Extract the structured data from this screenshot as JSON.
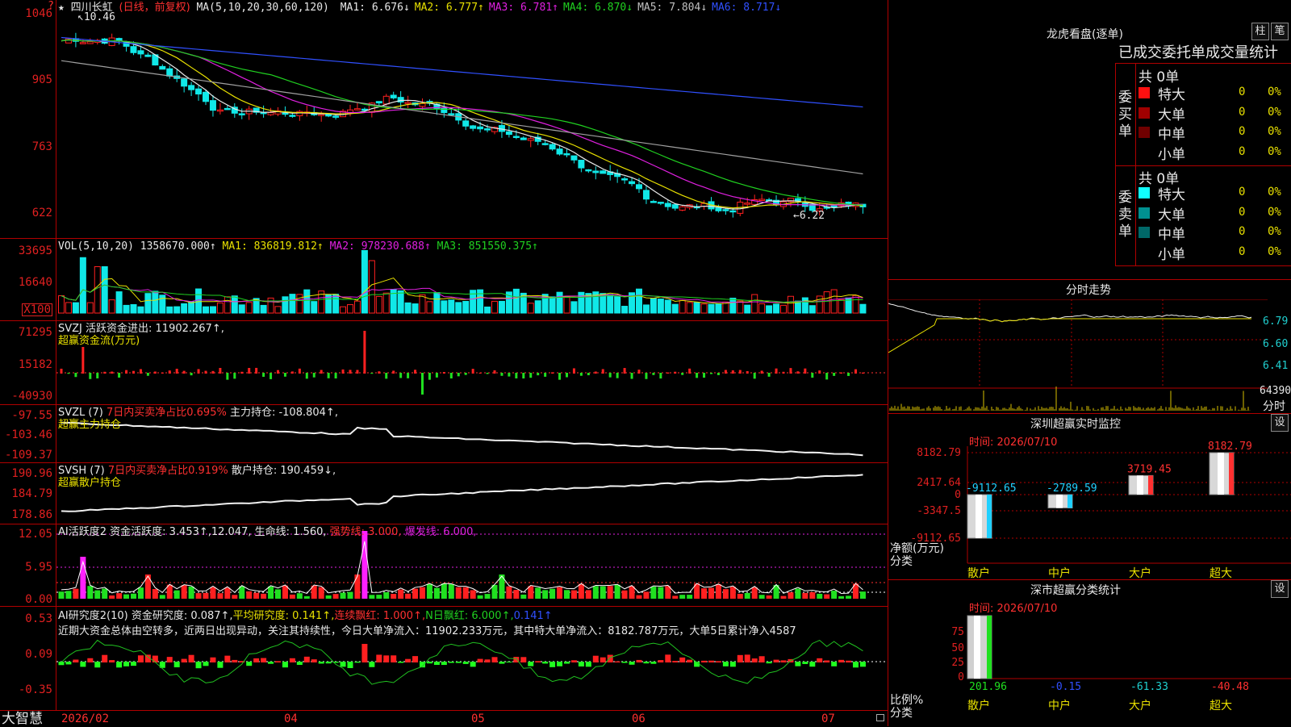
{
  "app": {
    "name": "大智慧"
  },
  "main_chart": {
    "stock_name": "四川长虹",
    "period": "(日线，前复权)",
    "ma_text": "MA(5,10,20,30,60,120)",
    "ma_values": [
      {
        "label": "MA1: 6.676↓",
        "color": "#e8e8e8"
      },
      {
        "label": "MA2: 6.777↑",
        "color": "#e8e000"
      },
      {
        "label": "MA3: 6.781↑",
        "color": "#e020e0"
      },
      {
        "label": "MA4: 6.870↓",
        "color": "#20d020"
      },
      {
        "label": "MA5: 7.804↓",
        "color": "#c0c0c0"
      },
      {
        "label": "MA6: 8.717↓",
        "color": "#3050ff"
      }
    ],
    "y_ticks": [
      "1046",
      "905",
      "763",
      "622"
    ],
    "high_marker": "10.46",
    "low_marker": "←6.22"
  },
  "vol_pane": {
    "header_name": "VOL(5,10,20)",
    "header_value": "1358670.000↑",
    "ma1": "MA1: 836819.812↑",
    "ma2": "MA2: 978230.688↑",
    "ma3": "MA3: 851550.375↑",
    "y_ticks": [
      "33695",
      "16640"
    ],
    "unit": "X100"
  },
  "svzj_pane": {
    "header": "SVZJ  活跃资金进出: 11902.267↑,",
    "sub": "超赢资金流(万元)",
    "y_ticks": [
      "71295",
      "15182",
      "-40930"
    ]
  },
  "svzl_pane": {
    "header_a": "SVZL (7) ",
    "header_b": "7日内买卖净占比0.695%",
    "header_c": " 主力持仓: -108.804↑,",
    "sub": "超赢主力持仓",
    "y_ticks": [
      "-97.55",
      "-103.46",
      "-109.37"
    ]
  },
  "svsh_pane": {
    "header_a": "SVSH (7) ",
    "header_b": "7日内买卖净占比0.919%",
    "header_c": " 散户持仓: 190.459↓,",
    "sub": "超赢散户持仓",
    "y_ticks": [
      "190.96",
      "184.79",
      "178.86"
    ]
  },
  "ai_active_pane": {
    "header_a": "AI活跃度2 资金活跃度: 3.453↑,12.047,",
    "header_b": "生命线: 1.560,",
    "header_c": "强势线: 3.000,",
    "header_d": "爆发线: 6.000,",
    "y_ticks": [
      "12.05",
      "5.95",
      "0.00"
    ]
  },
  "ai_research_pane": {
    "header_a": "AI研究度2(10) 资金研究度: 0.087↑,",
    "header_b": "平均研究度: 0.141↑,",
    "header_c": "连续飘红: 1.000↑,",
    "header_d": "N日飘红: 6.000↑,",
    "header_e": "0.141↑",
    "comment": "近期大资金总体由空转多，近两日出现异动，关注其持续性，今日大单净流入：11902.233万元，其中特大单净流入：8182.787万元，大单5日累计净入4587",
    "y_ticks": [
      "0.53",
      "0.09",
      "-0.35"
    ]
  },
  "x_axis": [
    "2026/02",
    "04",
    "05",
    "06",
    "07"
  ],
  "right_panel": {
    "lhb": {
      "title": "龙虎看盘(逐单)",
      "btn1": "柱",
      "btn2": "笔",
      "tabs": "已成交委托单成交量统计",
      "buy_label": "委买单",
      "buy_total": "共 0单",
      "sell_label": "委卖单",
      "sell_total": "共 0单",
      "buy_rows": [
        {
          "name": "特大",
          "count": "0",
          "pct": "0%",
          "color": "#ff1010"
        },
        {
          "name": "大单",
          "count": "0",
          "pct": "0%",
          "color": "#a00000"
        },
        {
          "name": "中单",
          "count": "0",
          "pct": "0%",
          "color": "#700000"
        },
        {
          "name": "小单",
          "count": "0",
          "pct": "0%",
          "color": "#000000"
        }
      ],
      "sell_rows": [
        {
          "name": "特大",
          "count": "0",
          "pct": "0%",
          "color": "#10ffff"
        },
        {
          "name": "大单",
          "count": "0",
          "pct": "0%",
          "color": "#009090"
        },
        {
          "name": "中单",
          "count": "0",
          "pct": "0%",
          "color": "#006868"
        },
        {
          "name": "小单",
          "count": "0",
          "pct": "0%",
          "color": "#000000"
        }
      ]
    },
    "intraday": {
      "title": "分时走势",
      "y_ticks": [
        "6.79",
        "6.60",
        "6.41"
      ],
      "vol_label": "64390",
      "tag": "分时"
    },
    "sz_monitor": {
      "title": "深圳超赢实时监控",
      "btn": "设",
      "date": "时间: 2026/07/10",
      "y_ticks": [
        "8182.79",
        "2417.64",
        "0",
        "-3347.5",
        "-9112.65"
      ],
      "y_label": "净额(万元)",
      "x_label": "分类",
      "categories": [
        "散户",
        "中户",
        "大户",
        "超大"
      ],
      "values": [
        "-9112.65",
        "-2789.59",
        "3719.45",
        "8182.79"
      ]
    },
    "sz_class": {
      "title": "深市超赢分类统计",
      "btn": "设",
      "date": "时间: 2026/07/10",
      "y_ticks": [
        "75",
        "50",
        "25",
        "0"
      ],
      "y_label": "比例%",
      "x_label": "分类",
      "categories": [
        "散户",
        "中户",
        "大户",
        "超大"
      ],
      "values": [
        "201.96",
        "-0.15",
        "-61.33",
        "-40.48"
      ]
    }
  },
  "colors": {
    "up": "#ff2020",
    "down": "#10e8e8",
    "grid": "#b00000"
  }
}
